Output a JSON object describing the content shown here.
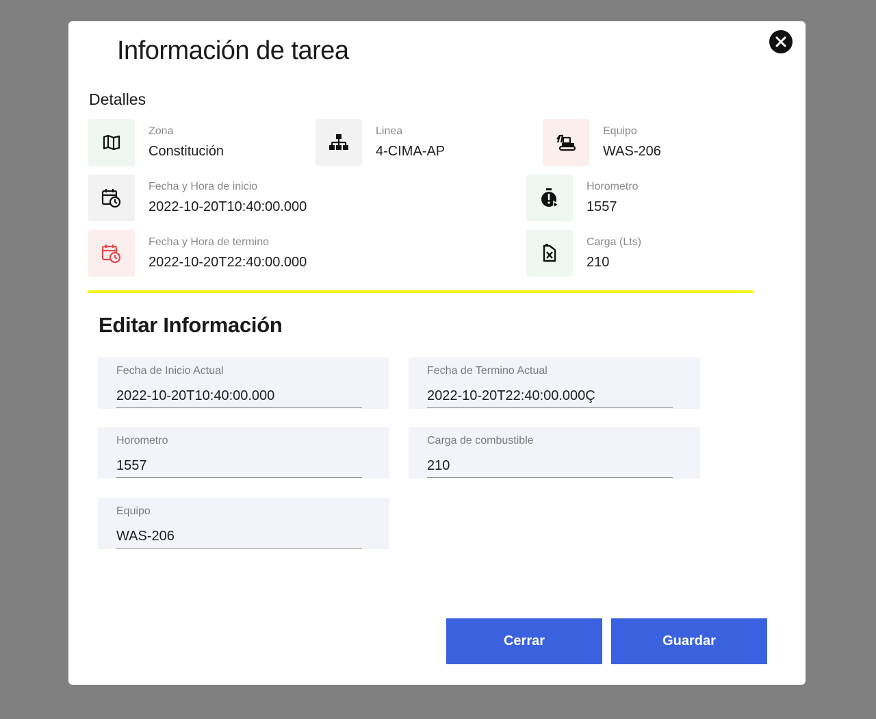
{
  "modal": {
    "title": "Información de tarea",
    "close_icon": "close-icon"
  },
  "details": {
    "title": "Detalles",
    "zona": {
      "label": "Zona",
      "value": "Constitución",
      "icon": "map-icon"
    },
    "linea": {
      "label": "Linea",
      "value": "4-CIMA-AP",
      "icon": "sitemap-icon"
    },
    "equipo": {
      "label": "Equipo",
      "value": "WAS-206",
      "icon": "excavator-icon"
    },
    "fecha_inicio": {
      "label": "Fecha y Hora de inicio",
      "value": "2022-10-20T10:40:00.000",
      "icon": "calendar-clock-icon"
    },
    "horometro": {
      "label": "Horometro",
      "value": "1557",
      "icon": "stopwatch-icon"
    },
    "fecha_termino": {
      "label": "Fecha y Hora de termino",
      "value": "2022-10-20T22:40:00.000",
      "icon": "calendar-clock-red-icon"
    },
    "carga": {
      "label": "Carga (Lts)",
      "value": "210",
      "icon": "fuel-can-icon"
    }
  },
  "edit": {
    "title": "Editar Información",
    "fecha_inicio": {
      "label": "Fecha de Inicio Actual",
      "value": "2022-10-20T10:40:00.000"
    },
    "fecha_termino": {
      "label": "Fecha de Termino Actual",
      "value": "2022-10-20T22:40:00.000Ç"
    },
    "horometro": {
      "label": "Horometro",
      "value": "1557"
    },
    "carga": {
      "label": "Carga de combustible",
      "value": "210"
    },
    "equipo": {
      "label": "Equipo",
      "value": "WAS-206"
    }
  },
  "buttons": {
    "cerrar": "Cerrar",
    "guardar": "Guardar"
  },
  "colors": {
    "overlay": "#808080",
    "primary": "#3b62de",
    "divider": "#f3f312",
    "accent_red": "#e8484b"
  }
}
